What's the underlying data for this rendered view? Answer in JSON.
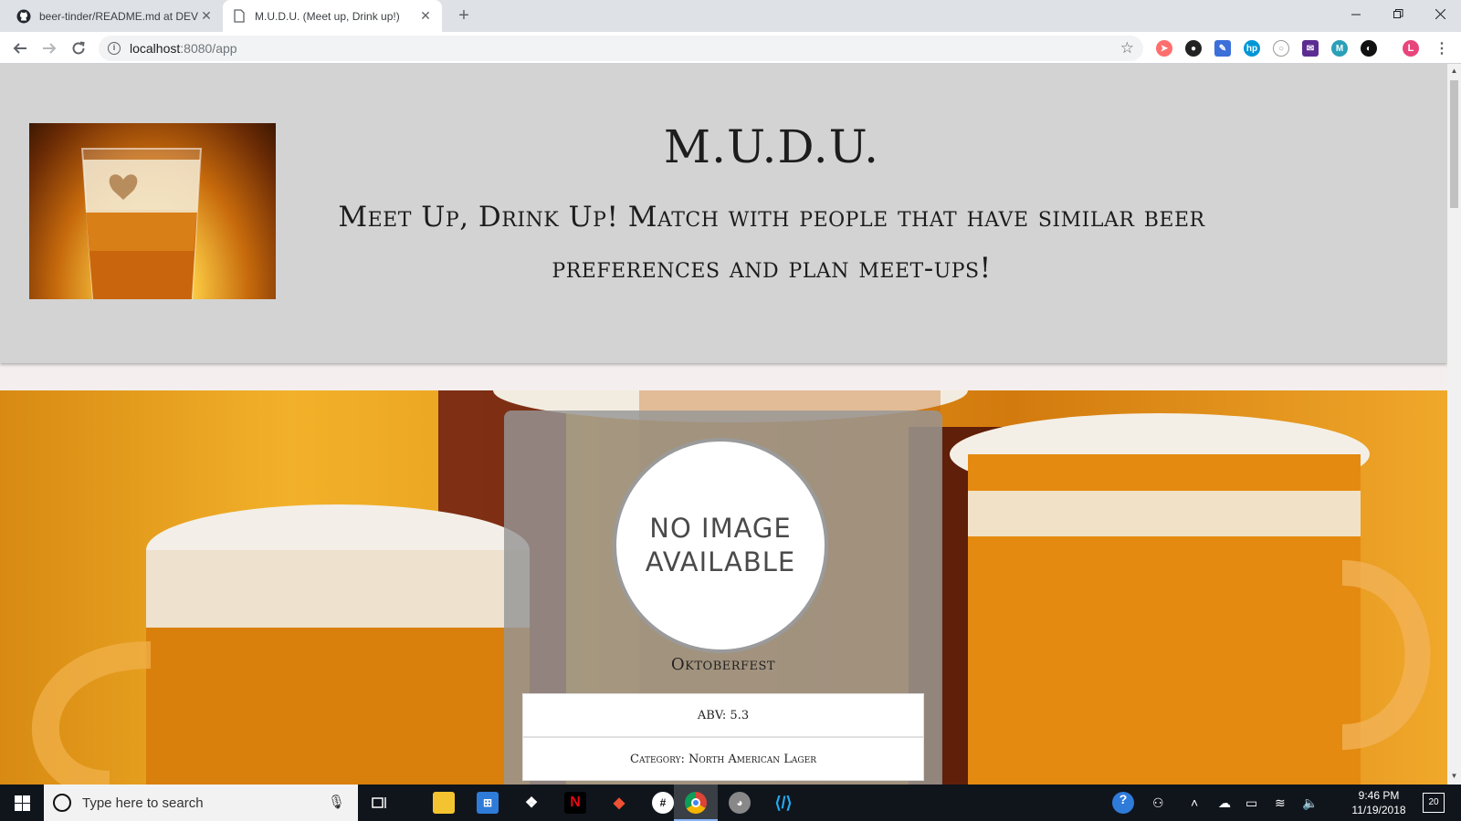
{
  "browser": {
    "tabs": [
      {
        "title": "beer-tinder/README.md at DEV",
        "active": false
      },
      {
        "title": "M.U.D.U. (Meet up, Drink up!)",
        "active": true
      }
    ],
    "url_host": "localhost",
    "url_rest": ":8080/app",
    "profile_initial": "L"
  },
  "page": {
    "site_title": "M.U.D.U.",
    "tagline": "Meet Up, Drink Up! Match with people that have similar beer preferences and plan meet-ups!",
    "card": {
      "image_placeholder_line1": "NO IMAGE",
      "image_placeholder_line2": "AVAILABLE",
      "beer_name": "Oktoberfest",
      "abv_text": "ABV: 5.3",
      "category_text": "Category: North American Lager"
    }
  },
  "taskbar": {
    "search_placeholder": "Type here to search",
    "time": "9:46 PM",
    "date": "11/19/2018",
    "notifications_count": "20"
  },
  "colors": {
    "header_bg": "#d3d3d3",
    "card_bg": "#969696",
    "taskbar_bg": "#10151c"
  }
}
